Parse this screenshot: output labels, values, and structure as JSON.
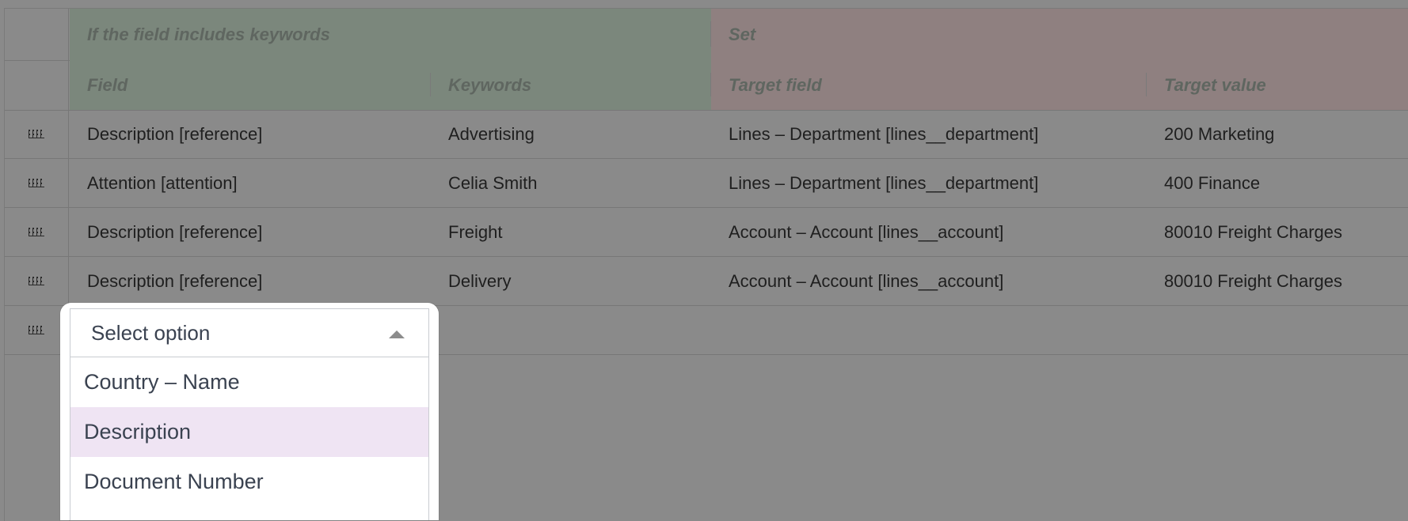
{
  "table": {
    "group_headers": {
      "condition": "If the field includes keywords",
      "action": "Set"
    },
    "columns": [
      "Field",
      "Keywords",
      "Target field",
      "Target value"
    ],
    "rows": [
      {
        "field": "Description [reference]",
        "keywords": "Advertising",
        "target_field": "Lines – Department [lines__department]",
        "target_value": "200 Marketing"
      },
      {
        "field": "Attention [attention]",
        "keywords": "Celia Smith",
        "target_field": "Lines – Department [lines__department]",
        "target_value": "400 Finance"
      },
      {
        "field": "Description [reference]",
        "keywords": "Freight",
        "target_field": "Account – Account [lines__account]",
        "target_value": "80010 Freight Charges"
      },
      {
        "field": "Description [reference]",
        "keywords": "Delivery",
        "target_field": "Account – Account [lines__account]",
        "target_value": "80010 Freight Charges"
      }
    ]
  },
  "dropdown": {
    "placeholder": "Select option",
    "options": [
      "Country – Name",
      "Description",
      "Document Number"
    ],
    "highlighted": "Description"
  },
  "icons": {
    "row_handle": "drag-handle-icon",
    "dropdown_toggle": "caret-up-icon"
  },
  "colors": {
    "condition_group": "#7b877c",
    "action_group": "#8f8080",
    "highlight_option": "#efe4f3"
  }
}
